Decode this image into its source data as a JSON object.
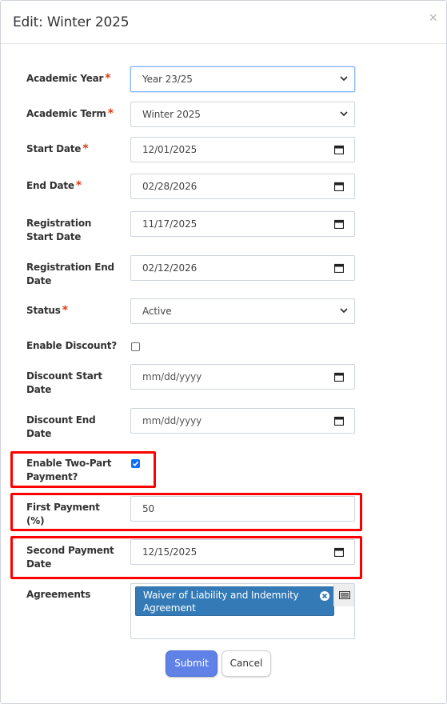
{
  "modal": {
    "title": "Edit: Winter 2025",
    "close_label": "×"
  },
  "form": {
    "academic_year": {
      "label": "Academic Year",
      "required": "*",
      "value": "Year 23/25"
    },
    "academic_term": {
      "label": "Academic Term",
      "required": "*",
      "value": "Winter 2025"
    },
    "start_date": {
      "label": "Start Date",
      "required": "*",
      "value": "12/01/2025"
    },
    "end_date": {
      "label": "End Date",
      "required": "*",
      "value": "02/28/2026"
    },
    "registration_start_date": {
      "label_line1": "Registration",
      "label_line2": "Start Date",
      "value": "11/17/2025"
    },
    "registration_end_date": {
      "label_line1": "Registration End",
      "label_line2": "Date",
      "value": "02/12/2026"
    },
    "status": {
      "label": "Status",
      "required": "*",
      "value": "Active"
    },
    "enable_discount": {
      "label": "Enable Discount?",
      "checked": false
    },
    "discount_start_date": {
      "label_line1": "Discount Start",
      "label_line2": "Date",
      "placeholder": "mm/dd/yyyy"
    },
    "discount_end_date": {
      "label_line1": "Discount End",
      "label_line2": "Date",
      "placeholder": "mm/dd/yyyy"
    },
    "enable_two_part_payment": {
      "label_line1": "Enable Two-Part",
      "label_line2": "Payment?",
      "checked": true
    },
    "first_payment": {
      "label_line1": "First Payment",
      "label_line2": "(%)",
      "value": "50"
    },
    "second_payment_date": {
      "label_line1": "Second Payment",
      "label_line2": "Date",
      "value": "12/15/2025"
    },
    "agreements": {
      "label": "Agreements",
      "selected": [
        {
          "line1": "Waiver of Liability and Indemnity",
          "line2": "Agreement"
        }
      ]
    }
  },
  "buttons": {
    "submit": "Submit",
    "cancel": "Cancel"
  },
  "colors": {
    "required": "#e03c10",
    "highlight": "#ff0000",
    "chip": "#337ab7",
    "submit": "#6082e6",
    "checkbox": "#0d6efd"
  }
}
